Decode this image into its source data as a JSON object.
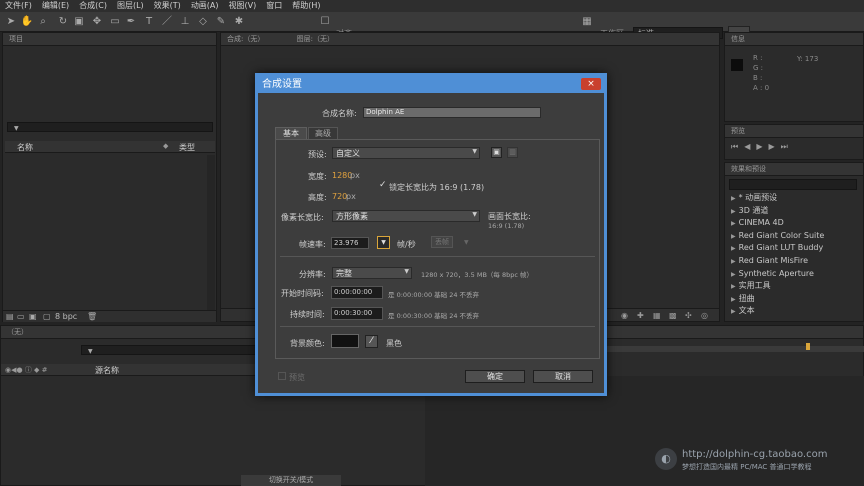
{
  "menu": [
    "文件(F)",
    "编辑(E)",
    "合成(C)",
    "图层(L)",
    "效果(T)",
    "动画(A)",
    "视图(V)",
    "窗口",
    "帮助(H)"
  ],
  "toolbar": {
    "snap_label": "对齐",
    "workspace_label": "工作区:",
    "workspace_value": "标准"
  },
  "panels": {
    "project_tab": "项目",
    "comp_tab": "合成:（无）",
    "layer_tab": "图层:（无）",
    "info_tab": "信息",
    "preview_tab": "预览",
    "effects_tab": "效果和预设",
    "timeline_tab": "（无）",
    "info_y": "Y: 173",
    "switch_label": "切换开关/模式"
  },
  "project": {
    "col_name": "名称",
    "col_type": "类型",
    "bpc": "8 bpc"
  },
  "timeline": {
    "col_source": "源名称"
  },
  "effects": {
    "items": [
      "* 动画预设",
      "3D 通道",
      "CINEMA 4D",
      "Red Giant Color Suite",
      "Red Giant LUT Buddy",
      "Red Giant MisFire",
      "Synthetic Aperture",
      "实用工具",
      "扭曲",
      "文本"
    ]
  },
  "dialog": {
    "title": "合成设置",
    "close": "×",
    "name_label": "合成名称:",
    "name_value": "Dolphin AE",
    "tab_basic": "基本",
    "tab_advanced": "高级",
    "preset_label": "预设:",
    "preset_value": "自定义",
    "width_label": "宽度:",
    "width_value": "1280",
    "height_label": "高度:",
    "height_value": "720",
    "px": "px",
    "lock_label": "锁定长宽比为 16:9 (1.78)",
    "check": "✓",
    "par_label": "像素长宽比:",
    "par_value": "方形像素",
    "frame_ar_label": "画面长宽比:",
    "frame_ar_value": "16:9 (1.78)",
    "fps_label": "帧速率:",
    "fps_value": "23.976",
    "fps_unit": "帧/秒",
    "fps_extra": "丢帧",
    "res_label": "分辨率:",
    "res_value": "完整",
    "res_info": "1280 x 720，3.5 MB（每 8bpc 帧）",
    "start_label": "开始时间码:",
    "start_value": "0:00:00:00",
    "start_info": "是 0:00:00:00  基础 24 不丢弃",
    "dur_label": "持续时间:",
    "dur_value": "0:00:30:00",
    "dur_info": "是 0:00:30:00  基础 24 不丢弃",
    "bg_label": "背景颜色:",
    "bg_name": "黑色",
    "bg_color": "#111111",
    "preview_label": "预览",
    "ok": "确定",
    "cancel": "取消"
  },
  "watermark": {
    "url": "http://dolphin-cg.taobao.com",
    "tagline": "梦想打造国内最精 PC/MAC 普通口学教程"
  },
  "colors": {
    "accent": "#4f8fd6",
    "close": "#c9402e",
    "value_orange": "#e2a23e"
  }
}
